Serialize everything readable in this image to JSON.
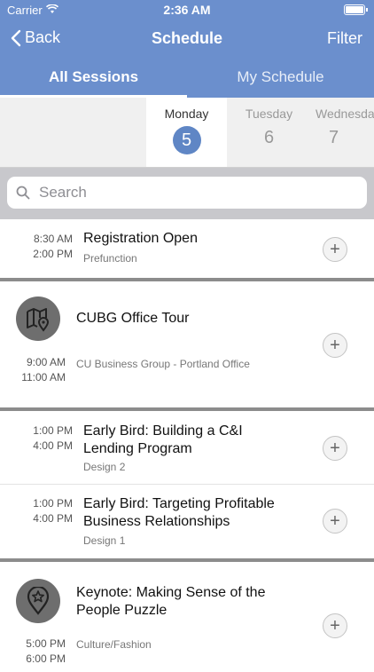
{
  "status": {
    "carrier": "Carrier",
    "time": "2:36 AM"
  },
  "nav": {
    "back_label": "Back",
    "title": "Schedule",
    "filter_label": "Filter"
  },
  "tabs": [
    {
      "label": "All Sessions"
    },
    {
      "label": "My Schedule"
    }
  ],
  "days": [
    {
      "name": "Monday",
      "num": "5"
    },
    {
      "name": "Tuesday",
      "num": "6"
    },
    {
      "name": "Wednesday",
      "num": "7"
    }
  ],
  "search": {
    "placeholder": "Search"
  },
  "sessions": [
    {
      "start": "8:30 AM",
      "end": "2:00 PM",
      "title": "Registration Open",
      "location": "Prefunction"
    },
    {
      "start": "9:00 AM",
      "end": "11:00 AM",
      "title": "CUBG Office Tour",
      "location": "CU Business Group - Portland Office"
    },
    {
      "start": "1:00 PM",
      "end": "4:00 PM",
      "title": "Early Bird: Building a C&I Lending Program",
      "location": "Design 2"
    },
    {
      "start": "1:00 PM",
      "end": "4:00 PM",
      "title": "Early Bird: Targeting Profitable Business Relationships",
      "location": "Design 1"
    },
    {
      "start": "5:00 PM",
      "end": "6:00 PM",
      "title": "Keynote: Making Sense of the People Puzzle",
      "location": "Culture/Fashion"
    }
  ],
  "add_symbol": "+",
  "colors": {
    "header": "#6b8fcd",
    "selected_day": "#5f86c5",
    "separator": "#8c8c8c"
  }
}
